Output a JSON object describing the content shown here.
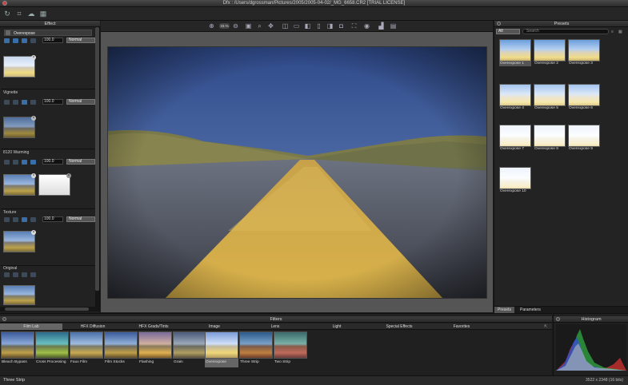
{
  "window": {
    "title": "Dfx : /Users/dgrossman/Pictures/2005/2005-04-02/_MG_6658.CR2 [TRIAL LICENSE]"
  },
  "toolbar": {
    "icons": [
      "refresh-icon",
      "crop-icon",
      "cloud-icon",
      "grid-icon"
    ]
  },
  "effect_panel": {
    "title": "Effect",
    "sections": [
      {
        "name": "Overexpose",
        "opacity": "100.0",
        "blend": "Normal"
      },
      {
        "name": "Vignette",
        "opacity": "100.0",
        "blend": "Normal"
      },
      {
        "name": "8120 Warming",
        "opacity": "100.0",
        "blend": "Normal"
      },
      {
        "name": "Texture",
        "opacity": "100.0",
        "blend": "Normal"
      },
      {
        "name": "Original"
      }
    ]
  },
  "viewer": {
    "zoom": "33.%"
  },
  "presets_panel": {
    "title": "Presets",
    "filter_value": "All",
    "search_placeholder": "Search",
    "items": [
      "Overexpose 1",
      "Overexpose 2",
      "Overexpose 3",
      "Overexpose 4",
      "Overexpose 5",
      "Overexpose 6",
      "Overexpose 7",
      "Overexpose 8",
      "Overexpose 9",
      "Overexpose 10"
    ],
    "tabs": [
      "Presets",
      "Parameters"
    ]
  },
  "filters_panel": {
    "title": "Filters",
    "tabs": [
      "Film Lab",
      "HFX Diffusion",
      "HFX Grads/Tints",
      "Image",
      "Lens",
      "Light",
      "Special Effects",
      "Favorites"
    ],
    "active_tab": "Film Lab",
    "items": [
      "Bleach Bypass",
      "Cross Processing",
      "Faux Film",
      "Film Stocks",
      "Flashing",
      "Grain",
      "Overexpose",
      "Three Strip",
      "Two Strip"
    ],
    "selected": "Overexpose"
  },
  "histogram": {
    "title": "Histogram",
    "dimensions": "3522 x 2348 (16 bits)"
  },
  "status": {
    "text": "Three Strip"
  },
  "colors": {
    "panel": "#222222",
    "selection": "#666666",
    "accent": "#3a76c4"
  }
}
